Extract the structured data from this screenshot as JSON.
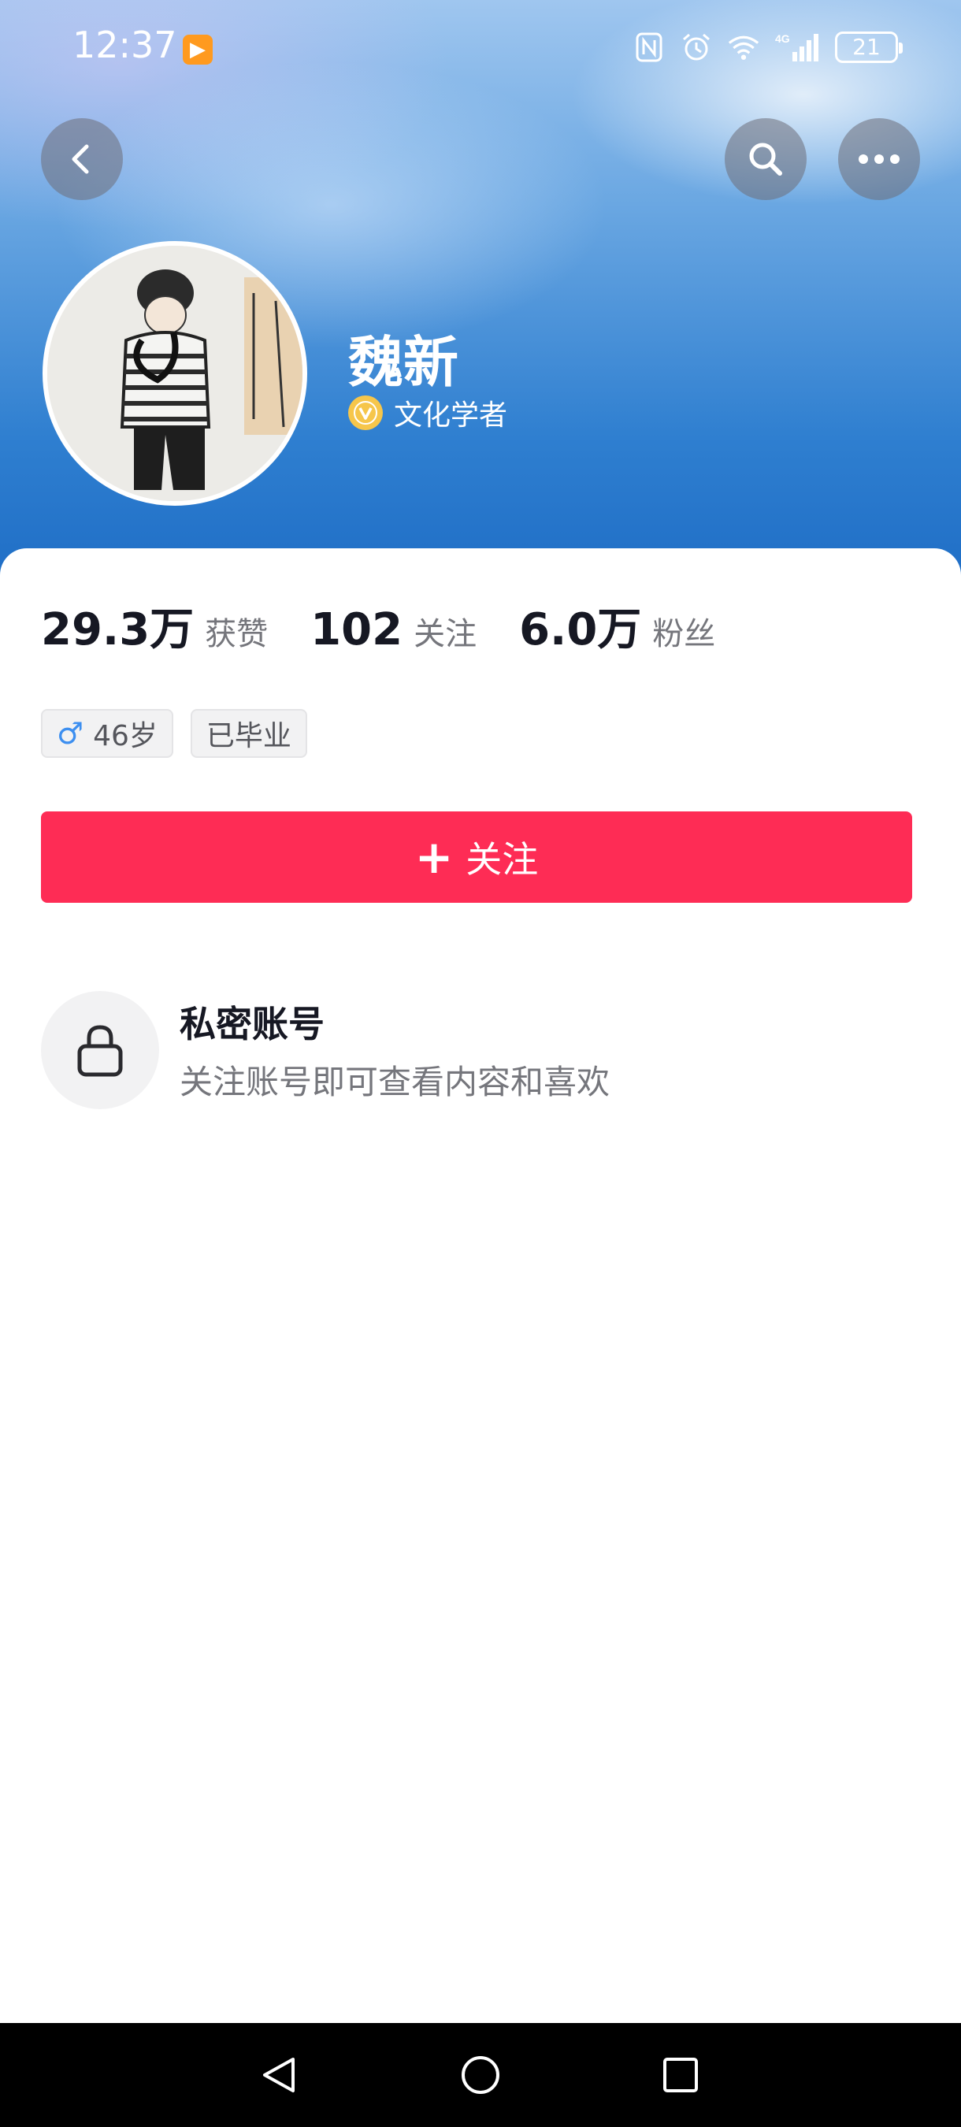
{
  "status_bar": {
    "time": "12:37",
    "app_icon": "play-badge-icon",
    "network": "4G",
    "battery": "21"
  },
  "header": {
    "back_icon": "back-chevron-icon",
    "search_icon": "search-icon",
    "more_icon": "more-dots-icon"
  },
  "profile": {
    "name": "魏新",
    "verification": "文化学者"
  },
  "stats": [
    {
      "value": "29.3万",
      "label": "获赞"
    },
    {
      "value": "102",
      "label": "关注"
    },
    {
      "value": "6.0万",
      "label": "粉丝"
    }
  ],
  "tags": {
    "gender_symbol": "♂",
    "age": "46岁",
    "education": "已毕业"
  },
  "follow_button": {
    "plus": "+",
    "label": "关注",
    "color": "#fe2c55"
  },
  "private_notice": {
    "title": "私密账号",
    "subtitle": "关注账号即可查看内容和喜欢"
  },
  "nav": {
    "back": "nav-back-icon",
    "home": "nav-home-icon",
    "recents": "nav-recents-icon"
  }
}
